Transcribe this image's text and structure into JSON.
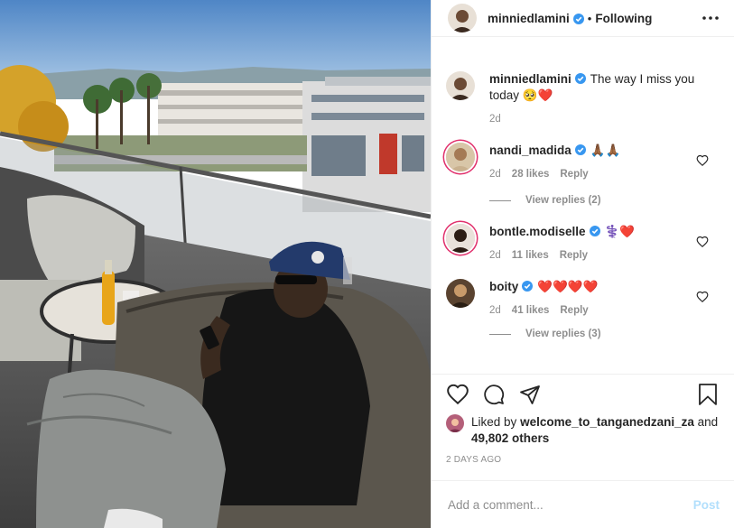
{
  "header": {
    "username": "minniedlamini",
    "separator": "•",
    "follow_status": "Following"
  },
  "caption": {
    "username": "minniedlamini",
    "text": "The way I miss you today 🥺❤️",
    "age": "2d"
  },
  "comments": [
    {
      "username": "nandi_madida",
      "text": "🙏🏾🙏🏾",
      "age": "2d",
      "likes": "28 likes",
      "reply": "Reply",
      "view_replies": "View replies (2)"
    },
    {
      "username": "bontle.modiselle",
      "text": "⚕️❤️",
      "age": "2d",
      "likes": "11 likes",
      "reply": "Reply"
    },
    {
      "username": "boity",
      "text": "❤️❤️❤️❤️",
      "age": "2d",
      "likes": "41 likes",
      "reply": "Reply",
      "view_replies": "View replies (3)"
    }
  ],
  "likes": {
    "prefix": "Liked by",
    "user": "welcome_to_tanganedzani_za",
    "joiner": "and",
    "count_text": "49,802 others"
  },
  "timestamp": "2 DAYS AGO",
  "comment_box": {
    "placeholder": "Add a comment...",
    "post_label": "Post"
  },
  "colors": {
    "verified": "#3897f0",
    "post_disabled": "#b2dffc",
    "muted": "#8e8e8e"
  }
}
